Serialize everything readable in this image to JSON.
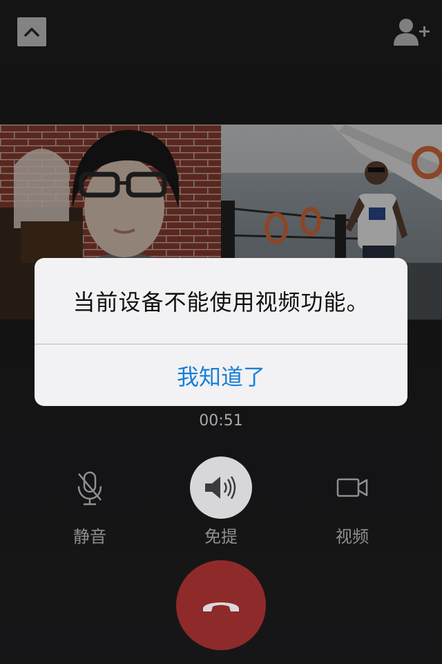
{
  "alert": {
    "message": "当前设备不能使用视频功能。",
    "button_label": "我知道了"
  },
  "call": {
    "duration": "00:51"
  },
  "controls": {
    "mute_label": "静音",
    "speaker_label": "免提",
    "video_label": "视频"
  },
  "icons": {
    "collapse": "chevron-up-icon",
    "add_contact": "add-person-icon",
    "mute": "microphone-off-icon",
    "speaker": "speaker-icon",
    "video": "video-camera-icon",
    "hangup": "phone-hangup-icon"
  },
  "colors": {
    "background": "#1d1d1f",
    "alert_bg": "#f2f2f4",
    "alert_button": "#1a7fd6",
    "hangup": "#8f2a2a",
    "speaker_active": "#d7d7d9"
  }
}
